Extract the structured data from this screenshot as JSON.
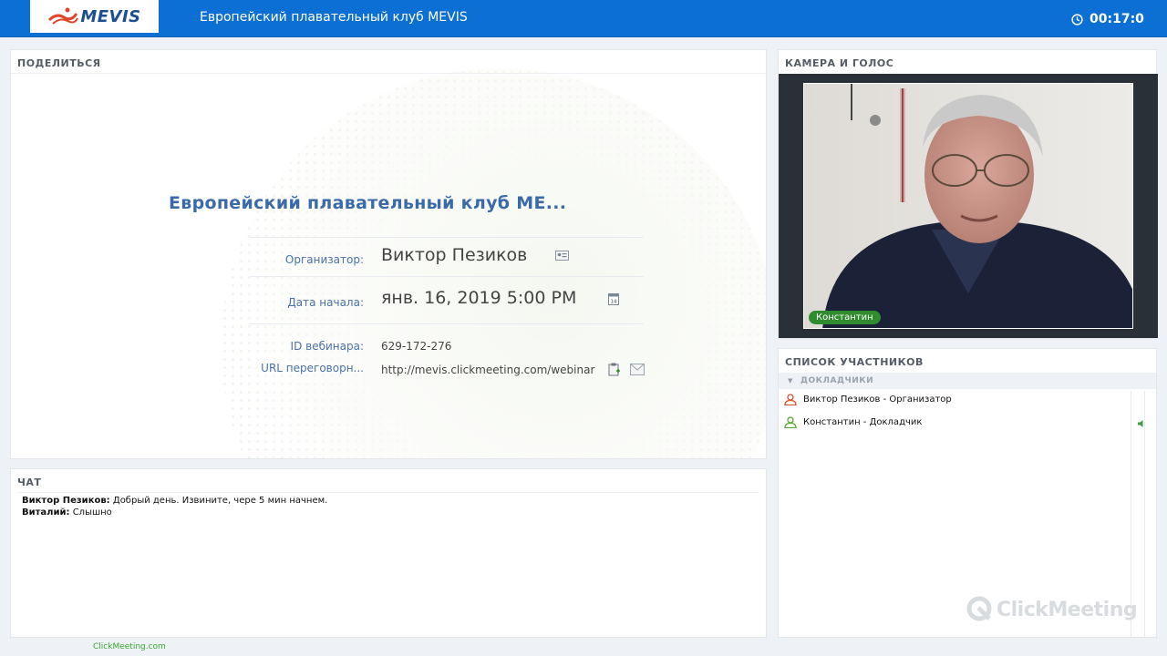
{
  "header": {
    "logo_text": "MEVIS",
    "room_title": "Европейский плавательный клуб MEVIS",
    "timer": "00:17:0"
  },
  "share": {
    "header": "ПОДЕЛИТЬСЯ",
    "meeting_title": "Европейский плавательный клуб МЕ...",
    "organizer_label": "Организатор:",
    "organizer_value": "Виктор Пезиков",
    "start_label": "Дата начала:",
    "start_value": "янв. 16, 2019 5:00 PM",
    "id_label": "ID вебинара:",
    "id_value": "629-172-276",
    "url_label": "URL переговорн...",
    "url_value": "http://mevis.clickmeeting.com/webinar"
  },
  "chat": {
    "header": "ЧАТ",
    "messages": [
      {
        "author": "Виктор Пезиков:",
        "text": "Добрый день. Извините, чере 5 мин начнем."
      },
      {
        "author": "Виталий:",
        "text": "Слышно"
      }
    ]
  },
  "camera": {
    "header": "КАМЕРА И ГОЛОС",
    "speaker_label": "Константин"
  },
  "participants": {
    "header": "СПИСОК УЧАСТНИКОВ",
    "group": "ДОКЛАДЧИКИ",
    "list": [
      {
        "name": "Виктор Пезиков  - Организатор",
        "color": "#d9532c"
      },
      {
        "name": "Константин  - Докладчик",
        "color": "#5aa832"
      }
    ]
  },
  "branding": {
    "clickmeeting_logo": "ClickMeeting",
    "footer_link": "ClickMeeting.com"
  },
  "colors": {
    "topbar": "#0b6fd3",
    "accent_blue": "#3a6aa8",
    "speaking_green": "#2e8b2e"
  }
}
